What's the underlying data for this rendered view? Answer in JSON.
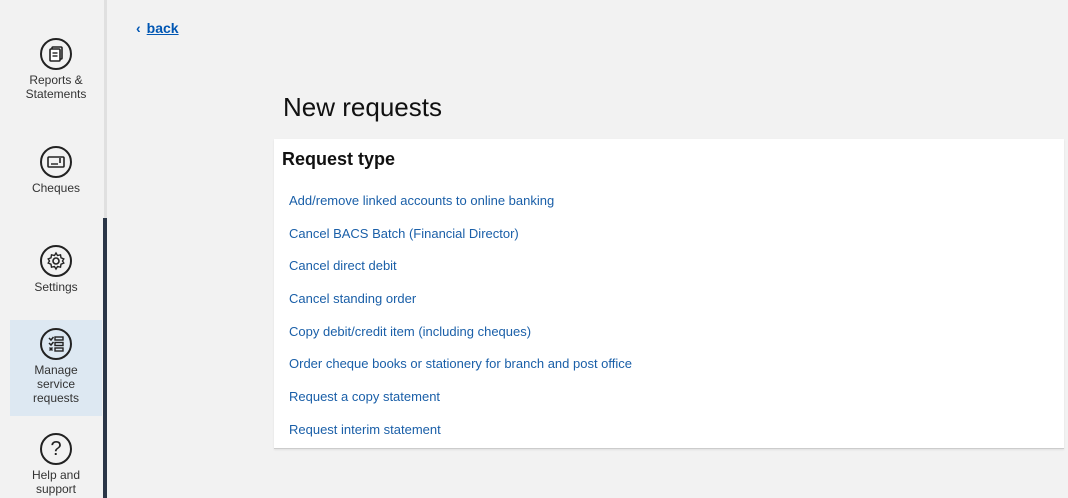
{
  "sidebar": {
    "items": [
      {
        "label": "Reports &\nStatements",
        "icon": "documents-icon"
      },
      {
        "label": "Cheques",
        "icon": "cheque-icon"
      },
      {
        "label": "Settings",
        "icon": "gear-icon"
      },
      {
        "label": "Manage\nservice\nrequests",
        "icon": "checklist-icon",
        "active": true
      },
      {
        "label": "Help and\nsupport",
        "icon": "question-icon"
      }
    ]
  },
  "back": {
    "label": "back"
  },
  "page": {
    "title": "New requests"
  },
  "card": {
    "title": "Request type",
    "requests": [
      "Add/remove linked accounts to online banking",
      "Cancel BACS Batch (Financial Director)",
      "Cancel direct debit",
      "Cancel standing order",
      "Copy debit/credit item (including cheques)",
      "Order cheque books or stationery for branch and post office",
      "Request a copy statement",
      "Request interim statement"
    ]
  },
  "colors": {
    "link": "#1a5fa8",
    "active_nav": "#dde8f2",
    "scroll_thumb": "#2b3647"
  }
}
